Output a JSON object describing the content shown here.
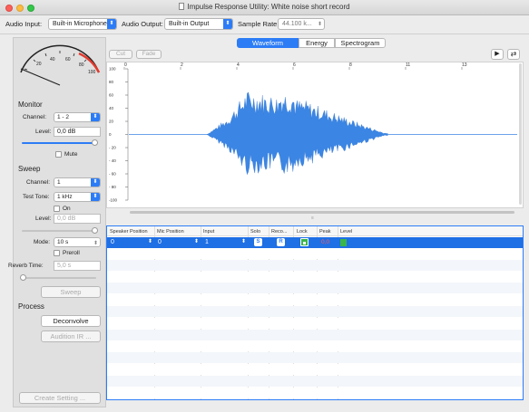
{
  "window": {
    "title": "Impulse Response Utility: White noise short record"
  },
  "toolbar": {
    "audio_input_label": "Audio Input:",
    "audio_input_value": "Built-in Microphone",
    "audio_output_label": "Audio Output:",
    "audio_output_value": "Built-in Output",
    "sample_rate_label": "Sample Rate:",
    "sample_rate_value": "44.100 k..."
  },
  "meter": {
    "scale": [
      "20",
      "40",
      "60",
      "80",
      "100"
    ]
  },
  "monitor": {
    "heading": "Monitor",
    "channel_label": "Channel:",
    "channel_value": "1 - 2",
    "level_label": "Level:",
    "level_value": "0,0 dB",
    "mute_label": "Mute"
  },
  "sweep": {
    "heading": "Sweep",
    "channel_label": "Channel:",
    "channel_value": "1",
    "test_tone_label": "Test Tone:",
    "test_tone_value": "1 kHz",
    "on_label": "On",
    "level_label": "Level:",
    "level_value": "0,0 dB",
    "mode_label": "Mode:",
    "mode_value": "10 s",
    "preroll_label": "Preroll",
    "reverb_time_label": "Reverb Time:",
    "reverb_time_value": "5,0 s",
    "sweep_button": "Sweep"
  },
  "process": {
    "heading": "Process",
    "deconvolve_button": "Deconvolve",
    "audition_button": "Audition IR ...",
    "create_setting_button": "Create Setting ..."
  },
  "editor": {
    "cut_button": "Cut",
    "fade_button": "Fade",
    "tabs": [
      "Waveform",
      "Energy",
      "Spectrogram"
    ],
    "active_tab": "Waveform",
    "play_icon": "play-icon",
    "loop_icon": "loop-icon"
  },
  "waveform": {
    "y_unit": "[%]",
    "y_ticks": [
      "100",
      "80",
      "60",
      "40",
      "20",
      "0",
      "- 20",
      "- 40",
      "- 60",
      "- 80",
      "-100"
    ],
    "x_ticks": [
      "0",
      "2",
      "4",
      "6",
      "8",
      "11",
      "13"
    ],
    "color": "#3b86e4"
  },
  "table": {
    "columns": [
      "Speaker Position",
      "Mic Position",
      "Input",
      "Solo",
      "Reco...",
      "Lock",
      "Peak",
      "Level"
    ],
    "rows": [
      {
        "speaker_position": "0",
        "mic_position": "0",
        "input": "1",
        "solo": "S",
        "record": "R",
        "peak": "0,0"
      }
    ],
    "selection_color": "#1f6fe5"
  }
}
